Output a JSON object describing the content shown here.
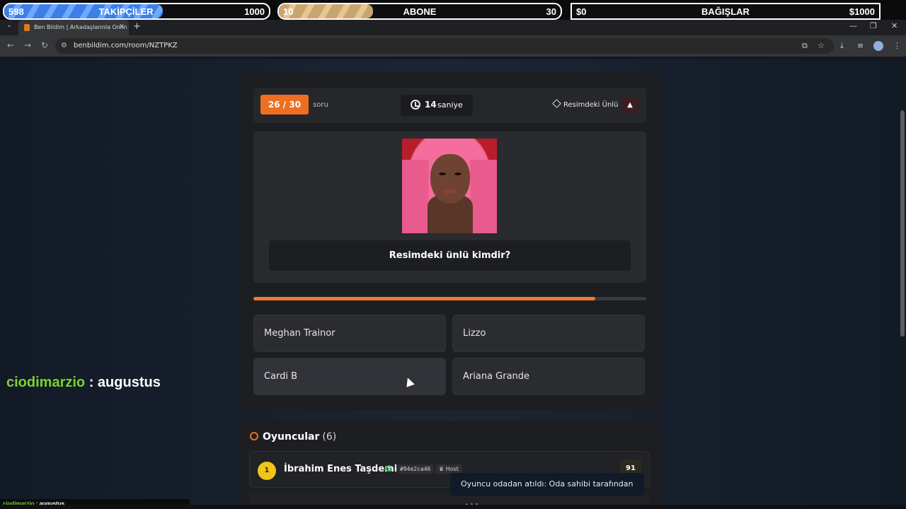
{
  "overlay": {
    "followers": {
      "current": "598",
      "label": "TAKİPÇİLER",
      "goal": "1000",
      "progress": 0.598
    },
    "subscribers": {
      "current": "10",
      "label": "ABONE",
      "goal": "30",
      "progress": 0.333
    },
    "donations": {
      "current": "$0",
      "label": "BAĞIŞLAR",
      "goal": "$1000",
      "progress": 0
    }
  },
  "browser": {
    "tab_title": "Ben Bildim | Arkadaşlarınla Onlin",
    "url": "benbildim.com/room/NZTPKZ"
  },
  "quiz": {
    "counter": "26 / 30",
    "counter_suffix": "soru",
    "timer_value": "14",
    "timer_label": "saniye",
    "category": "Resimdeki Ünlü",
    "question": "Resimdeki ünlü kimdir?",
    "time_progress": 0.87,
    "answers": [
      "Meghan Trainor",
      "Lizzo",
      "Cardi B",
      "Ariana Grande"
    ]
  },
  "players": {
    "title": "Oyuncular",
    "count": "(6)",
    "list": [
      {
        "rank": "1",
        "name": "İbrahim Enes Taşdemir",
        "provider_icon": "G",
        "id": "#94e2ca46",
        "role": "Host",
        "score": "91"
      }
    ]
  },
  "toast": "Oyuncu odadan atıldı: Oda sahibi tarafından atıldı",
  "chat": {
    "user": "ciodimarzio",
    "separator": " : ",
    "message": "augustus"
  },
  "colors": {
    "accent": "#ee6f22",
    "chat_user": "#7bd32f",
    "rank_gold": "#f0c419"
  }
}
